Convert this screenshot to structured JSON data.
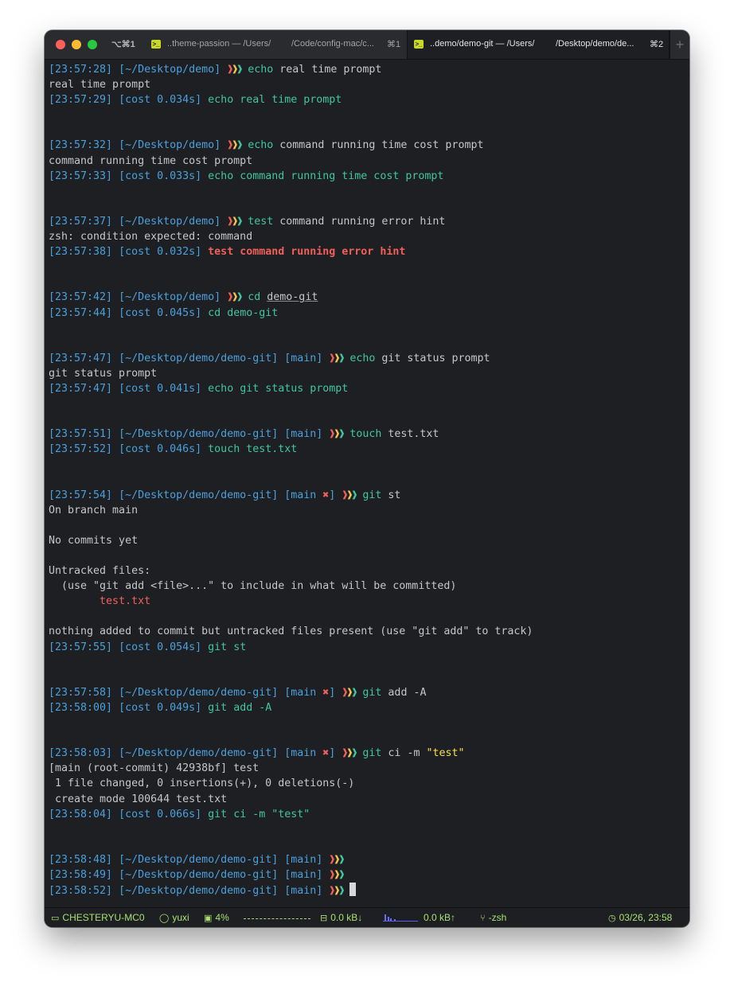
{
  "window": {
    "shortcut": "⌥⌘1",
    "tabs": [
      {
        "title": "..theme-passion — /Users/",
        "title2": "/Code/config-mac/c...",
        "key": "⌘1",
        "active": false
      },
      {
        "title": "..demo/demo-git — /Users/",
        "title2": "/Desktop/demo/de...",
        "key": "⌘2",
        "active": true
      }
    ],
    "new_tab": "+"
  },
  "terminal": {
    "prompt_glyph": "❱❱❱",
    "blocks": [
      {
        "ts": "[23:57:28]",
        "path": "[~/Desktop/demo]",
        "cmd": "echo",
        "args": " real time prompt",
        "output": [
          "real time prompt"
        ],
        "end_ts": "[23:57:29]",
        "cost": "[cost 0.034s]",
        "end_cmd": "echo real time prompt"
      },
      {
        "ts": "[23:57:32]",
        "path": "[~/Desktop/demo]",
        "cmd": "echo",
        "args": " command running time cost prompt",
        "output": [
          "command running time cost prompt"
        ],
        "end_ts": "[23:57:33]",
        "cost": "[cost 0.033s]",
        "end_cmd": "echo command running time cost prompt"
      },
      {
        "ts": "[23:57:37]",
        "path": "[~/Desktop/demo]",
        "cmd": "test",
        "args": " command running error hint",
        "output": [
          "zsh: condition expected: command"
        ],
        "end_ts": "[23:57:38]",
        "cost": "[cost 0.032s]",
        "end_cmd": "test command running error hint"
      },
      {
        "ts": "[23:57:42]",
        "path": "[~/Desktop/demo]",
        "cmd": "cd",
        "args": "demo-git",
        "end_ts": "[23:57:44]",
        "cost": "[cost 0.045s]",
        "end_cmd": "cd demo-git"
      },
      {
        "ts": "[23:57:47]",
        "path": "[~/Desktop/demo/demo-git]",
        "branch": "[main]",
        "cmd": "echo",
        "args": " git status prompt",
        "output": [
          "git status prompt"
        ],
        "end_ts": "[23:57:47]",
        "cost": "[cost 0.041s]",
        "end_cmd": "echo git status prompt"
      },
      {
        "ts": "[23:57:51]",
        "path": "[~/Desktop/demo/demo-git]",
        "branch": "[main]",
        "cmd": "touch",
        "args": " test.txt",
        "end_ts": "[23:57:52]",
        "cost": "[cost 0.046s]",
        "end_cmd": "touch test.txt"
      },
      {
        "ts": "[23:57:54]",
        "path": "[~/Desktop/demo/demo-git]",
        "branch_open": "[main",
        "dirty": "✖",
        "branch_close": "]",
        "cmd": "git",
        "args": " st",
        "output": [
          "On branch main",
          "",
          "No commits yet",
          "",
          "Untracked files:",
          "  (use \"git add <file>...\" to include in what will be committed)"
        ],
        "untracked": "test.txt",
        "output2": [
          "",
          "nothing added to commit but untracked files present (use \"git add\" to track)"
        ],
        "end_ts": "[23:57:55]",
        "cost": "[cost 0.054s]",
        "end_cmd": "git st"
      },
      {
        "ts": "[23:57:58]",
        "path": "[~/Desktop/demo/demo-git]",
        "branch_open": "[main",
        "dirty": "✖",
        "branch_close": "]",
        "cmd": "git",
        "args": " add -A",
        "end_ts": "[23:58:00]",
        "cost": "[cost 0.049s]",
        "end_cmd": "git add -A"
      },
      {
        "ts": "[23:58:03]",
        "path": "[~/Desktop/demo/demo-git]",
        "branch_open": "[main",
        "dirty": "✖",
        "branch_close": "]",
        "cmd": "git",
        "args": " ci -m ",
        "str": "\"test\"",
        "output": [
          "[main (root-commit) 42938bf] test",
          " 1 file changed, 0 insertions(+), 0 deletions(-)",
          " create mode 100644 test.txt"
        ],
        "end_ts": "[23:58:04]",
        "cost": "[cost 0.066s]",
        "end_cmd": "git ci -m \"test\""
      }
    ],
    "idle_prompts": [
      {
        "ts": "[23:58:48]",
        "path": "[~/Desktop/demo/demo-git]",
        "branch": "[main]"
      },
      {
        "ts": "[23:58:49]",
        "path": "[~/Desktop/demo/demo-git]",
        "branch": "[main]"
      },
      {
        "ts": "[23:58:52]",
        "path": "[~/Desktop/demo/demo-git]",
        "branch": "[main]"
      }
    ]
  },
  "statusbar": {
    "host": "CHESTERYU-MC0",
    "user": "yuxi",
    "cpu": "4%",
    "net_down": "0.0 kB↓",
    "net_up": "0.0 kB↑",
    "shell": "-zsh",
    "datetime": "03/26, 23:58"
  }
}
